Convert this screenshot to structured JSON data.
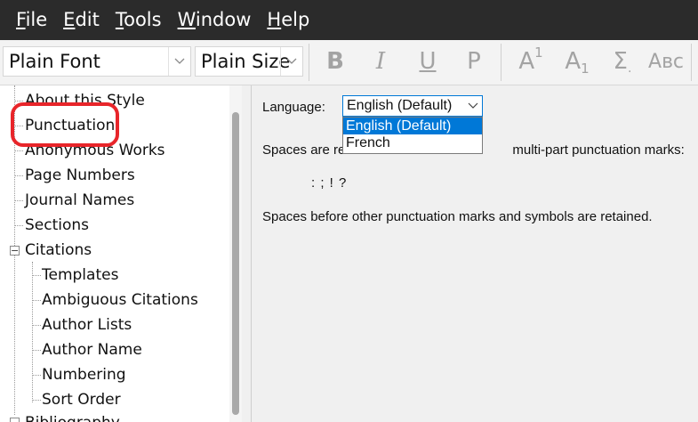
{
  "menu": {
    "items": [
      {
        "label": "File",
        "mnemonic": "F",
        "rest": "ile"
      },
      {
        "label": "Edit",
        "mnemonic": "E",
        "rest": "dit"
      },
      {
        "label": "Tools",
        "mnemonic": "T",
        "rest": "ools"
      },
      {
        "label": "Window",
        "mnemonic": "W",
        "rest": "indow"
      },
      {
        "label": "Help",
        "mnemonic": "H",
        "rest": "elp"
      }
    ]
  },
  "toolbar": {
    "font_combo": "Plain Font",
    "size_combo": "Plain Size",
    "bold": "B",
    "italic": "I",
    "underline": "U",
    "plain": "P",
    "superscript": "A",
    "superscript_mark": "1",
    "subscript": "A",
    "subscript_mark": "1",
    "symbol": "Σ",
    "smallcaps": "Aʙᴄ"
  },
  "tree": {
    "items": [
      {
        "label": "About this Style"
      },
      {
        "label": "Punctuation"
      },
      {
        "label": "Anonymous Works"
      },
      {
        "label": "Page Numbers"
      },
      {
        "label": "Journal Names"
      },
      {
        "label": "Sections"
      },
      {
        "label": "Citations",
        "expander": "−"
      },
      {
        "label": "Templates"
      },
      {
        "label": "Ambiguous Citations"
      },
      {
        "label": "Author Lists"
      },
      {
        "label": "Author Name"
      },
      {
        "label": "Numbering"
      },
      {
        "label": "Sort Order"
      },
      {
        "label": "Bibliography",
        "expander": "−"
      }
    ]
  },
  "panel": {
    "language_label": "Language:",
    "language_selected": "English (Default)",
    "options": [
      "English (Default)",
      "French"
    ],
    "para1_start": "Spaces are re",
    "para1_end": "multi-part punctuation marks:",
    "marks": ": ; ! ?",
    "para2": "Spaces before other punctuation marks and symbols are retained."
  },
  "colors": {
    "menubar_bg": "#2b2b2b",
    "highlight": "#e8252a",
    "accent": "#0078d7"
  }
}
